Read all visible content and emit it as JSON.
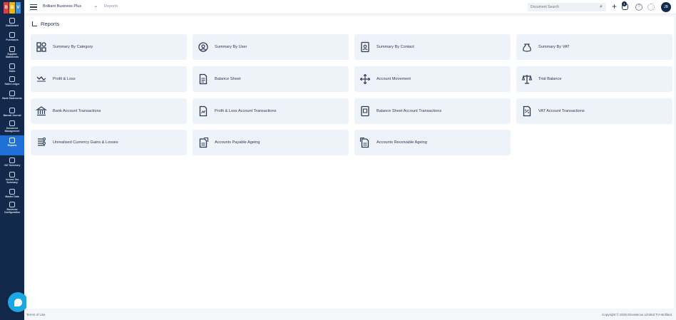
{
  "brand": {
    "logo_letters": [
      "B",
      "B",
      "V"
    ],
    "logo_colors": [
      "#e43d3d",
      "#f2b705",
      "#3b8ed8"
    ]
  },
  "sidebar": {
    "items": [
      {
        "label": "Dashboard",
        "icon": "gauge-icon"
      },
      {
        "label": "Purchases",
        "icon": "cart-icon"
      },
      {
        "label": "Supplier Statements",
        "icon": "statement-icon"
      },
      {
        "label": "Sales",
        "icon": "receipt-icon"
      },
      {
        "label": "Sales Ledger",
        "icon": "ledger-icon"
      },
      {
        "label": "Bank Statements",
        "icon": "bank-icon"
      },
      {
        "label": "Manual Journal",
        "icon": "journal-icon"
      },
      {
        "label": "Document Management",
        "icon": "document-icon"
      },
      {
        "label": "Reports",
        "icon": "chart-icon",
        "active": true
      },
      {
        "label": "VAT Summary",
        "icon": "vat-icon"
      },
      {
        "label": "Income Tax Summary",
        "icon": "tax-icon"
      },
      {
        "label": "Master Data",
        "icon": "database-icon"
      },
      {
        "label": "Business Configuration",
        "icon": "settings-icon"
      }
    ]
  },
  "topbar": {
    "company": "Brilliant Business Plus",
    "breadcrumb": "Reports",
    "search_placeholder": "Document Search",
    "notification_count": "1",
    "help_label": "?",
    "avatar_initials": "JB"
  },
  "page": {
    "title": "Reports",
    "cards": [
      {
        "label": "Summary By Category",
        "icon": "category-icon"
      },
      {
        "label": "Summary By User",
        "icon": "user-icon"
      },
      {
        "label": "Summary By Contact",
        "icon": "contact-icon"
      },
      {
        "label": "Summary By VAT",
        "icon": "vat-bag-icon"
      },
      {
        "label": "Profit & Loss",
        "icon": "profit-loss-icon"
      },
      {
        "label": "Balance Sheet",
        "icon": "balance-sheet-icon"
      },
      {
        "label": "Account Movement",
        "icon": "account-movement-icon"
      },
      {
        "label": "Trial Balance",
        "icon": "trial-balance-icon"
      },
      {
        "label": "Bank Account Transactions",
        "icon": "bank-transactions-icon"
      },
      {
        "label": "Profit & Loss Account Transactions",
        "icon": "pl-transactions-icon"
      },
      {
        "label": "Balance Sheet Account Transactions",
        "icon": "bs-transactions-icon"
      },
      {
        "label": "VAT Account Transactions",
        "icon": "vat-transactions-icon"
      },
      {
        "label": "Unrealised Currency Gains & Losses",
        "icon": "currency-icon"
      },
      {
        "label": "Accounts Payable Ageing",
        "icon": "payable-icon"
      },
      {
        "label": "Accounts Receivable Ageing",
        "icon": "receivable-icon"
      }
    ]
  },
  "footer": {
    "terms": "Terms of Use",
    "copyright": "Copyright © 2025 Elevatecus Limited T/A Brilliant"
  },
  "colors": {
    "sidebar": "#13294b",
    "active": "#1e6fd6",
    "card": "#eef3fa",
    "chat": "#1aa7e6"
  }
}
